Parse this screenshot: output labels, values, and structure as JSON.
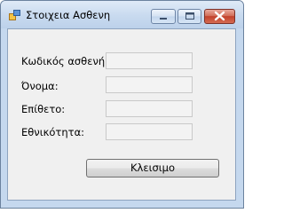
{
  "window": {
    "title": "Στοιχεια Ασθενη"
  },
  "form": {
    "fields": [
      {
        "label": "Κωδικός ασθενή:",
        "value": ""
      },
      {
        "label": "Όνομα:",
        "value": ""
      },
      {
        "label": "Επίθετο:",
        "value": ""
      },
      {
        "label": "Εθνικότητα:",
        "value": ""
      }
    ],
    "close_button_label": "Κλεισιμο"
  },
  "colors": {
    "close_caption": "#c2402a",
    "title_bar": "#c8daef",
    "client_bg": "#f0f0f0"
  },
  "icons": [
    "app-icon",
    "minimize-icon",
    "maximize-icon",
    "close-icon"
  ]
}
